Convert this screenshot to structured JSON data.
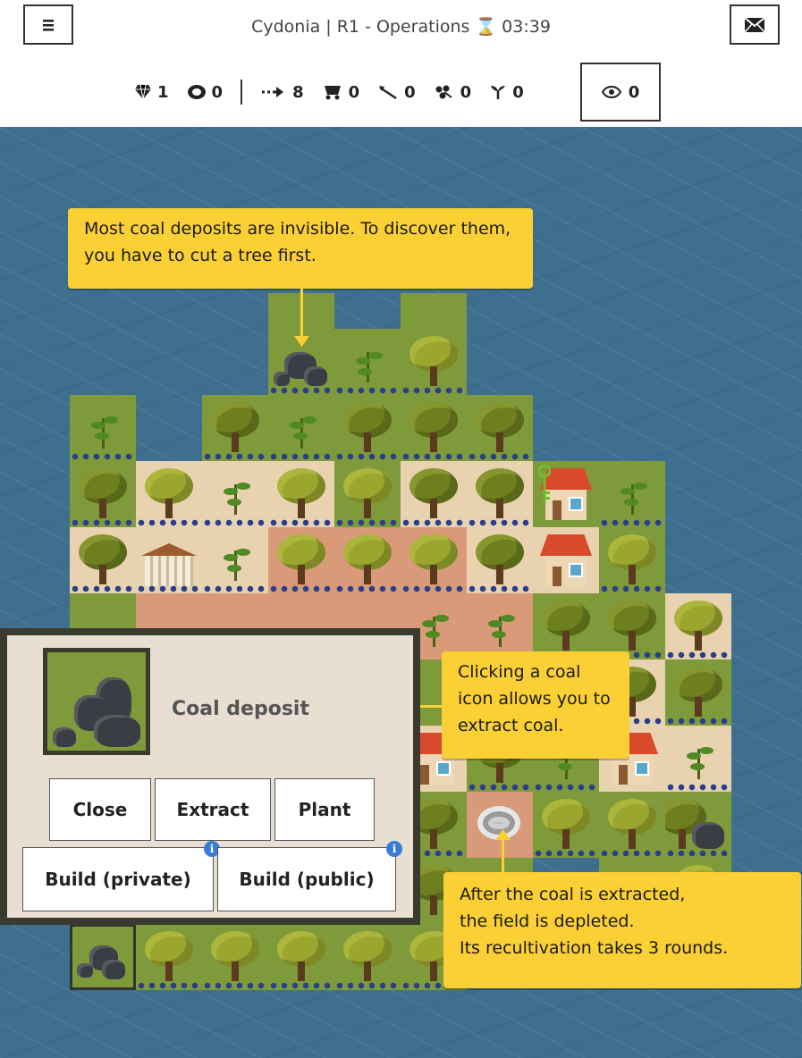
{
  "header": {
    "title": "Cydonia | R1 - Operations ⌛ 03:39",
    "menu_icon": "hamburger-icon",
    "mail_icon": "envelope-icon"
  },
  "stats": {
    "gems": "1",
    "coins": "0",
    "moves": "8",
    "carts": "0",
    "axes": "0",
    "seeds": "0",
    "plants": "0",
    "views": "0"
  },
  "callouts": {
    "top": "Most coal deposits are invisible. To discover them, you have to cut a tree first.",
    "middle": "Clicking a coal icon allows you to extract coal.",
    "bottom": [
      "After the coal is extracted,",
      "the field is depleted.",
      "Its recultivation takes 3 rounds."
    ]
  },
  "panel": {
    "title": "Coal deposit",
    "close": "Close",
    "extract": "Extract",
    "plant": "Plant",
    "build_private": "Build (private)",
    "build_public": "Build (public)",
    "info": "i"
  },
  "colors": {
    "water": "#3f6f8e",
    "grass": "#7e9a3a",
    "sand": "#e8d2b0",
    "clay": "#d89a78",
    "callout": "#fbd034"
  }
}
